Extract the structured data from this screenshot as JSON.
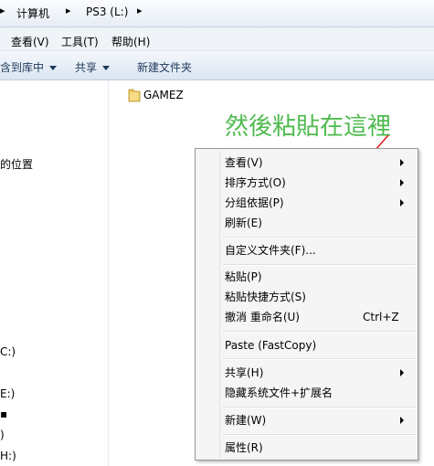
{
  "address": {
    "crumbs": [
      "计算机",
      "PS3 (L:)"
    ]
  },
  "menubar": [
    "查看(V)",
    "工具(T)",
    "帮助(H)"
  ],
  "commandbar": {
    "include_library": "含到库中",
    "share": "共享",
    "new_folder": "新建文件夹"
  },
  "navpane": [
    "的位置",
    "C:)",
    "E:)",
    "H:)"
  ],
  "files": [
    {
      "name": "GAMEZ",
      "icon": "folder-icon"
    }
  ],
  "annotation": "然後粘貼在這裡",
  "annotation_color": "#4dbb4d",
  "arrow_color": "#e02020",
  "context_menu": {
    "items": [
      {
        "label": "查看(V)",
        "submenu": true
      },
      {
        "label": "排序方式(O)",
        "submenu": true
      },
      {
        "label": "分组依据(P)",
        "submenu": true
      },
      {
        "label": "刷新(E)"
      },
      {
        "label": "自定义文件夹(F)..."
      },
      {
        "label": "粘贴(P)"
      },
      {
        "label": "粘贴快捷方式(S)"
      },
      {
        "label": "撤消 重命名(U)",
        "shortcut": "Ctrl+Z"
      },
      {
        "label": "Paste (FastCopy)"
      },
      {
        "label": "共享(H)",
        "submenu": true
      },
      {
        "label": "隐藏系统文件+扩展名"
      },
      {
        "label": "新建(W)",
        "submenu": true
      },
      {
        "label": "属性(R)"
      }
    ]
  }
}
